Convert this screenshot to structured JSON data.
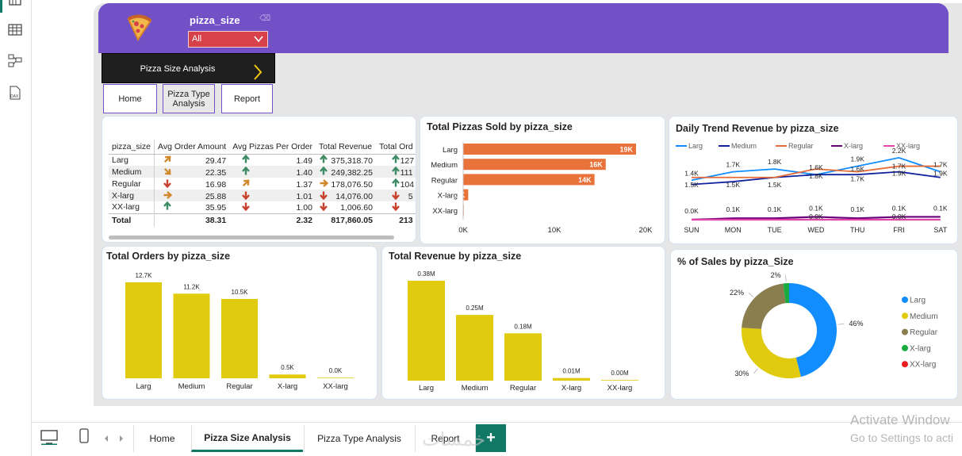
{
  "header": {
    "slicer_title": "pizza_size",
    "slicer_value": "All"
  },
  "nav": {
    "current": "Pizza Size Analysis",
    "buttons": [
      "Home",
      "Pizza Type\nAnalysis",
      "Report"
    ]
  },
  "matrix": {
    "columns": [
      "pizza_size",
      "Avg Order Amount",
      "Avg Pizzas Per Order",
      "Total Revenue",
      "Total Ord"
    ],
    "rows": [
      {
        "size": "Larg",
        "avg_amount": "29.47",
        "amount_dir": "up-right",
        "avg_pizzas": "1.49",
        "pizzas_dir": "up",
        "revenue": "375,318.70",
        "revenue_dir": "up",
        "orders": "127",
        "orders_dir": "up"
      },
      {
        "size": "Medium",
        "avg_amount": "22.35",
        "amount_dir": "down-right",
        "avg_pizzas": "1.40",
        "pizzas_dir": "up",
        "revenue": "249,382.25",
        "revenue_dir": "up",
        "orders": "111",
        "orders_dir": "up"
      },
      {
        "size": "Regular",
        "avg_amount": "16.98",
        "amount_dir": "down",
        "avg_pizzas": "1.37",
        "pizzas_dir": "up-right",
        "revenue": "178,076.50",
        "revenue_dir": "right",
        "orders": "104",
        "orders_dir": "up"
      },
      {
        "size": "X-larg",
        "avg_amount": "25.88",
        "amount_dir": "right",
        "avg_pizzas": "1.01",
        "pizzas_dir": "down",
        "revenue": "14,076.00",
        "revenue_dir": "down",
        "orders": "5",
        "orders_dir": "down"
      },
      {
        "size": "XX-larg",
        "avg_amount": "35.95",
        "amount_dir": "up",
        "avg_pizzas": "1.00",
        "pizzas_dir": "down",
        "revenue": "1,006.60",
        "revenue_dir": "down",
        "orders": "",
        "orders_dir": "down"
      }
    ],
    "total": {
      "label": "Total",
      "avg_amount": "38.31",
      "avg_pizzas": "2.32",
      "revenue": "817,860.05",
      "orders": "213"
    }
  },
  "colors": {
    "header": "#7251c7",
    "orange_bar": "#e8723a",
    "yellow_bar": "#e0cb0e",
    "arrow_green": "#3d8b64",
    "arrow_orange": "#d0882a",
    "arrow_red": "#c8412f",
    "donut_larg": "#118dff",
    "donut_medium": "#e0cb0e",
    "donut_regular": "#8a7d4e",
    "donut_xlarg": "#1aab40",
    "donut_xxlarg": "#e81c1c",
    "accent": "#117865"
  },
  "chart_data": [
    {
      "type": "bar",
      "orientation": "horizontal",
      "title": "Total Pizzas Sold by pizza_size",
      "categories": [
        "Larg",
        "Medium",
        "Regular",
        "X-larg",
        "XX-larg"
      ],
      "values": [
        18956,
        15635,
        14403,
        552,
        28
      ],
      "data_labels": [
        "19K",
        "16K",
        "14K",
        "1K",
        ""
      ],
      "xticks": [
        "0K",
        "10K",
        "20K"
      ],
      "xlim": [
        0,
        20000
      ]
    },
    {
      "type": "line",
      "title": "Daily Trend Revenue by pizza_size",
      "x": [
        "SUN",
        "MON",
        "TUE",
        "WED",
        "THU",
        "FRI",
        "SAT"
      ],
      "legend_position": "top-left",
      "series": [
        {
          "name": "Larg",
          "color": "#118dff",
          "values": [
            1400,
            1700,
            1800,
            1600,
            1900,
            2200,
            1700
          ],
          "labels": [
            "1.4K",
            "1.7K",
            "1.8K",
            "1.6K",
            "1.9K",
            "2.2K",
            "1.7K"
          ]
        },
        {
          "name": "Medium",
          "color": "#12239e",
          "values": [
            1250,
            1350,
            1500,
            1600,
            1600,
            1700,
            1500
          ],
          "labels": [
            "",
            "",
            "",
            "",
            "1.6K",
            "1.7K",
            ""
          ]
        },
        {
          "name": "Regular",
          "color": "#e66c37",
          "values": [
            1500,
            1500,
            1500,
            1800,
            1700,
            1900,
            1900
          ],
          "labels": [
            "1.5K",
            "1.5K",
            "1.5K",
            "1.8K",
            "1.7K",
            "1.9K",
            "1.9K"
          ]
        },
        {
          "name": "X-larg",
          "color": "#6b007b",
          "values": [
            0,
            50,
            50,
            100,
            50,
            100,
            100
          ],
          "labels": [
            "0.0K",
            "0.1K",
            "0.1K",
            "0.1K",
            "0.1K",
            "0.1K",
            "0.1K"
          ]
        },
        {
          "name": "XX-larg",
          "color": "#e044a7",
          "values": [
            0,
            0,
            0,
            0,
            0,
            0,
            0
          ],
          "labels": [
            "",
            "",
            "",
            "0.0K",
            "",
            "0.0K",
            ""
          ]
        }
      ]
    },
    {
      "type": "bar",
      "title": "Total Orders by pizza_size",
      "categories": [
        "Larg",
        "Medium",
        "Regular",
        "X-larg",
        "XX-larg"
      ],
      "values": [
        12.7,
        11.2,
        10.5,
        0.5,
        0.0
      ],
      "data_labels": [
        "12.7K",
        "11.2K",
        "10.5K",
        "0.5K",
        "0.0K"
      ],
      "unit": "K"
    },
    {
      "type": "bar",
      "title": "Total Revenue by pizza_size",
      "categories": [
        "Larg",
        "Medium",
        "Regular",
        "X-larg",
        "XX-larg"
      ],
      "values": [
        0.38,
        0.25,
        0.18,
        0.01,
        0.0
      ],
      "data_labels": [
        "0.38M",
        "0.25M",
        "0.18M",
        "0.01M",
        "0.00M"
      ],
      "unit": "M"
    },
    {
      "type": "pie",
      "title": "% of Sales by pizza_Size",
      "categories": [
        "Larg",
        "Medium",
        "Regular",
        "X-larg",
        "XX-larg"
      ],
      "values": [
        46,
        30,
        22,
        2,
        0
      ],
      "data_labels": [
        "46%",
        "30%",
        "22%",
        "2%",
        ""
      ],
      "legend_position": "right"
    }
  ],
  "tabs": {
    "items": [
      "Home",
      "Pizza Size Analysis",
      "Pizza Type Analysis",
      "Report"
    ],
    "active": "Pizza Size Analysis"
  },
  "watermark": {
    "line1": "Activate Window",
    "line2": "Go to Settings to acti",
    "logo_text": "خمسات"
  }
}
